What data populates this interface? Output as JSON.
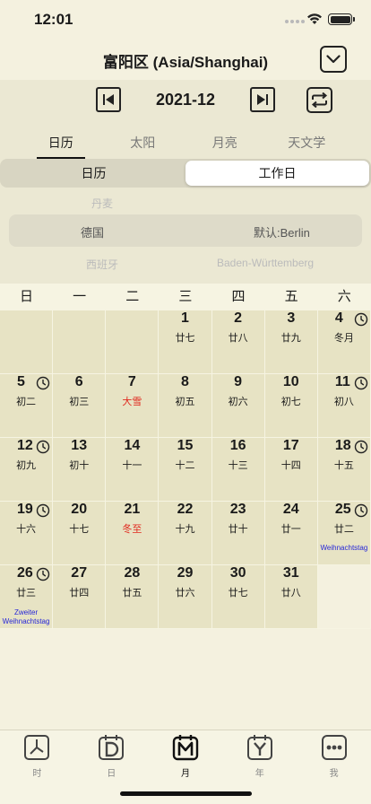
{
  "status": {
    "time": "12:01"
  },
  "nav": {
    "title": "富阳区 (Asia/Shanghai)"
  },
  "month": {
    "label": "2021-12"
  },
  "tabs": [
    "日历",
    "太阳",
    "月亮",
    "天文学"
  ],
  "segment": {
    "left": "日历",
    "right": "工作日"
  },
  "picker": {
    "above_left": "丹麦",
    "selected_left": "德国",
    "selected_right": "默认:Berlin",
    "below_left": "西班牙",
    "below_right": "Baden-Württemberg"
  },
  "weekdays": [
    "日",
    "一",
    "二",
    "三",
    "四",
    "五",
    "六"
  ],
  "days": [
    {
      "d": "1",
      "lunar": "廿七"
    },
    {
      "d": "2",
      "lunar": "廿八"
    },
    {
      "d": "3",
      "lunar": "廿九"
    },
    {
      "d": "4",
      "lunar": "冬月"
    },
    {
      "d": "5",
      "lunar": "初二"
    },
    {
      "d": "6",
      "lunar": "初三"
    },
    {
      "d": "7",
      "lunar": "大雪"
    },
    {
      "d": "8",
      "lunar": "初五"
    },
    {
      "d": "9",
      "lunar": "初六"
    },
    {
      "d": "10",
      "lunar": "初七"
    },
    {
      "d": "11",
      "lunar": "初八"
    },
    {
      "d": "12",
      "lunar": "初九"
    },
    {
      "d": "13",
      "lunar": "初十"
    },
    {
      "d": "14",
      "lunar": "十一"
    },
    {
      "d": "15",
      "lunar": "十二"
    },
    {
      "d": "16",
      "lunar": "十三"
    },
    {
      "d": "17",
      "lunar": "十四"
    },
    {
      "d": "18",
      "lunar": "十五"
    },
    {
      "d": "19",
      "lunar": "十六"
    },
    {
      "d": "20",
      "lunar": "十七"
    },
    {
      "d": "21",
      "lunar": "冬至"
    },
    {
      "d": "22",
      "lunar": "十九"
    },
    {
      "d": "23",
      "lunar": "廿十"
    },
    {
      "d": "24",
      "lunar": "廿一"
    },
    {
      "d": "25",
      "lunar": "廿二",
      "holiday": "Weihnachtstag"
    },
    {
      "d": "26",
      "lunar": "廿三",
      "holiday": "Zweiter Weihnachtstag"
    },
    {
      "d": "27",
      "lunar": "廿四"
    },
    {
      "d": "28",
      "lunar": "廿五"
    },
    {
      "d": "29",
      "lunar": "廿六"
    },
    {
      "d": "30",
      "lunar": "廿七"
    },
    {
      "d": "31",
      "lunar": "廿八"
    }
  ],
  "tabbar": [
    {
      "label": "时",
      "icon": "clock-tab-icon"
    },
    {
      "label": "日",
      "icon": "day-tab-icon"
    },
    {
      "label": "月",
      "icon": "month-tab-icon"
    },
    {
      "label": "年",
      "icon": "year-tab-icon"
    },
    {
      "label": "我",
      "icon": "more-tab-icon"
    }
  ],
  "colors": {
    "background": "#f4f1df",
    "cell": "#e7e3c4",
    "solar_term": "#e02a1f",
    "holiday": "#2525d8"
  }
}
